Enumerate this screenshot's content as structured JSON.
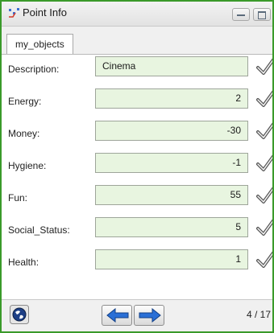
{
  "window": {
    "title": "Point Info"
  },
  "tabs": [
    {
      "label": "my_objects"
    }
  ],
  "fields": [
    {
      "label": "Description:",
      "value": "Cinema"
    },
    {
      "label": "Energy:",
      "value": "2"
    },
    {
      "label": "Money:",
      "value": "-30"
    },
    {
      "label": "Hygiene:",
      "value": "-1"
    },
    {
      "label": "Fun:",
      "value": "55"
    },
    {
      "label": "Social_Status:",
      "value": "5"
    },
    {
      "label": "Health:",
      "value": "1"
    }
  ],
  "footer": {
    "counter": "4 / 17"
  },
  "icons": {
    "app": "scatter-plot-icon",
    "confirm": "checkmark-icon",
    "globe": "globe-icon",
    "prev": "arrow-left-icon",
    "next": "arrow-right-icon"
  },
  "colors": {
    "window_border": "#3a9a2a",
    "field_bg": "#e8f5e0",
    "nav_arrow": "#2a6fd6"
  }
}
